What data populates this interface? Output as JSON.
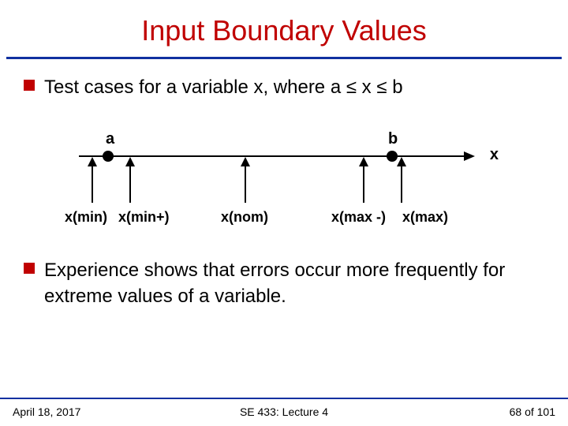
{
  "title": "Input Boundary Values",
  "bullets": [
    "Test cases for a variable x, where a ≤  x ≤ b",
    "Experience shows that errors occur more frequently for extreme values of a variable."
  ],
  "diagram": {
    "endpoint_a": "a",
    "endpoint_b": "b",
    "axis_label": "x",
    "cases": {
      "min": "x(min)",
      "min_p": "x(min+)",
      "nom": "x(nom)",
      "max_m": "x(max -)",
      "max": "x(max)"
    }
  },
  "footer": {
    "left": "April 18, 2017",
    "center": "SE 433: Lecture 4",
    "right": "68 of 101"
  }
}
